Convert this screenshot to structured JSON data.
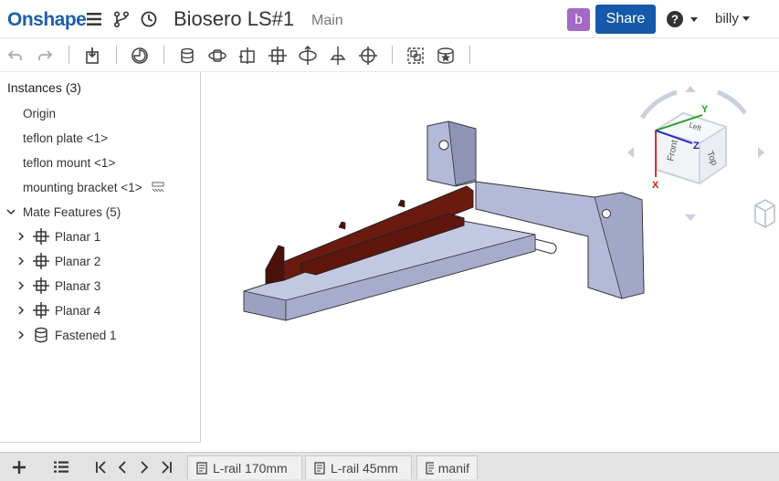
{
  "header": {
    "logo": "Onshape",
    "doc_title": "Biosero LS#1",
    "workspace": "Main",
    "avatar_letter": "b",
    "share_label": "Share",
    "user_name": "billy"
  },
  "panel": {
    "title": "Instances (3)",
    "instances": [
      "Origin",
      "teflon plate <1>",
      "teflon mount <1>",
      "mounting bracket <1>"
    ],
    "mate_group": "Mate Features (5)",
    "mates": [
      {
        "label": "Planar 1",
        "icon": "planar-mate-icon"
      },
      {
        "label": "Planar 2",
        "icon": "planar-mate-icon"
      },
      {
        "label": "Planar 3",
        "icon": "planar-mate-icon"
      },
      {
        "label": "Planar 4",
        "icon": "planar-mate-icon"
      },
      {
        "label": "Fastened 1",
        "icon": "fastened-mate-icon"
      }
    ]
  },
  "viewcube": {
    "faces": [
      "Front",
      "Top",
      "Left"
    ],
    "axes": [
      "X",
      "Y",
      "Z"
    ]
  },
  "tabs": [
    "L-rail 170mm",
    "L-rail 45mm",
    "manif"
  ],
  "colors": {
    "brand": "#1d5fae",
    "share": "#1559a8",
    "avatar": "#a26ac4",
    "part": "#b4b9d8",
    "rail": "#6b1a10"
  }
}
